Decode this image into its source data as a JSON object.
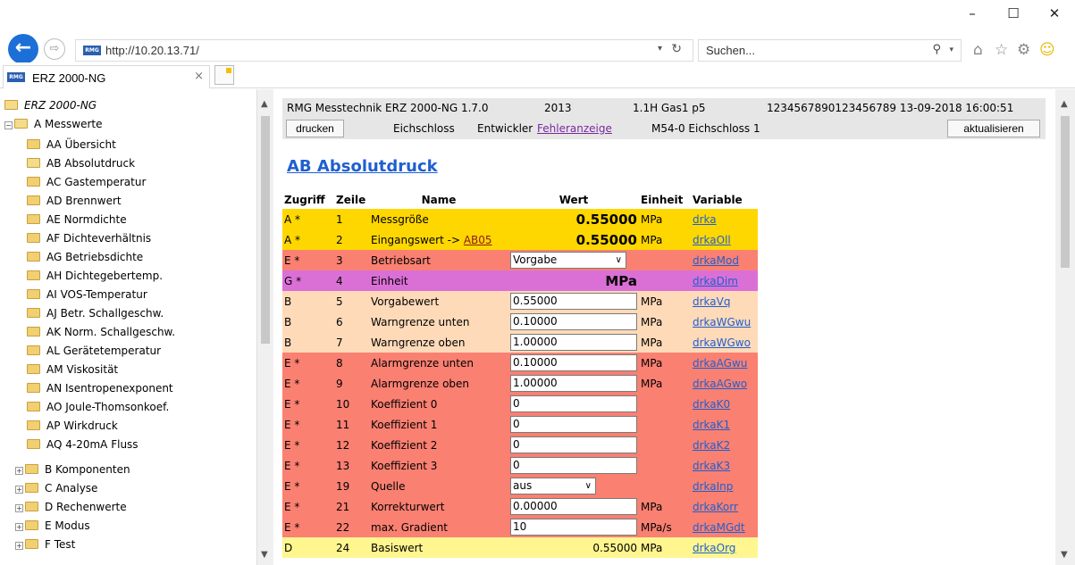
{
  "browser": {
    "url": "http://10.20.13.71/",
    "search_placeholder": "Suchen...",
    "tab_title": "ERZ 2000-NG",
    "logo_text": "RMG"
  },
  "tree": {
    "root": "ERZ 2000-NG",
    "open_group": "A Messwerte",
    "children": [
      "AA Übersicht",
      "AB Absolutdruck",
      "AC Gastemperatur",
      "AD Brennwert",
      "AE Normdichte",
      "AF Dichteverhältnis",
      "AG Betriebsdichte",
      "AH Dichtegebertemp.",
      "AI VOS-Temperatur",
      "AJ Betr. Schallgeschw.",
      "AK Norm. Schallgeschw.",
      "AL Gerätetemperatur",
      "AM Viskosität",
      "AN Isentropenexponent",
      "AO Joule-Thomsonkoef.",
      "AP Wirkdruck",
      "AQ 4-20mA Fluss"
    ],
    "groups": [
      "B Komponenten",
      "C Analyse",
      "D Rechenwerte",
      "E Modus",
      "F Test"
    ]
  },
  "status": {
    "device": "RMG Messtechnik ERZ 2000-NG 1.7.0",
    "year": "2013",
    "gas": "1.1H Gas1 p5",
    "serial_time": "1234567890123456789 13-09-2018 16:00:51",
    "print_label": "drucken",
    "eichschloss": "Eichschloss",
    "entwickler": "Entwickler",
    "fehler_link": "Fehleranzeige",
    "m54": "M54-0 Eichschloss 1",
    "refresh_label": "aktualisieren"
  },
  "page_title": "AB Absolutdruck",
  "table": {
    "headers": [
      "Zugriff",
      "Zeile",
      "Name",
      "Wert",
      "Einheit",
      "Variable"
    ],
    "rows": [
      {
        "zugriff": "A *",
        "zeile": "1",
        "name": "Messgröße",
        "wert": "0.55000",
        "einheit": "MPa",
        "variable": "drka",
        "type": "big",
        "color": "#ffd700"
      },
      {
        "zugriff": "A *",
        "zeile": "2",
        "name": "Eingangswert ->",
        "name_link": "AB05",
        "wert": "0.55000",
        "einheit": "MPa",
        "variable": "drkaOll",
        "type": "big",
        "color": "#ffd700"
      },
      {
        "zugriff": "E *",
        "zeile": "3",
        "name": "Betriebsart",
        "wert": "Vorgabe",
        "einheit": "",
        "variable": "drkaMod",
        "type": "select",
        "color": "#fa8072"
      },
      {
        "zugriff": "G *",
        "zeile": "4",
        "name": "Einheit",
        "wert": "MPa",
        "einheit": "",
        "variable": "drkaDim",
        "type": "big",
        "color": "#da70d6"
      },
      {
        "zugriff": "B",
        "zeile": "5",
        "name": "Vorgabewert",
        "wert": "0.55000",
        "einheit": "MPa",
        "variable": "drkaVq",
        "type": "input",
        "color": "#ffdab9"
      },
      {
        "zugriff": "B",
        "zeile": "6",
        "name": "Warngrenze unten",
        "wert": "0.10000",
        "einheit": "MPa",
        "variable": "drkaWGwu",
        "type": "input",
        "color": "#ffdab9"
      },
      {
        "zugriff": "B",
        "zeile": "7",
        "name": "Warngrenze oben",
        "wert": "1.00000",
        "einheit": "MPa",
        "variable": "drkaWGwo",
        "type": "input",
        "color": "#ffdab9"
      },
      {
        "zugriff": "E *",
        "zeile": "8",
        "name": "Alarmgrenze unten",
        "wert": "0.10000",
        "einheit": "MPa",
        "variable": "drkaAGwu",
        "type": "input",
        "color": "#fa8072"
      },
      {
        "zugriff": "E *",
        "zeile": "9",
        "name": "Alarmgrenze oben",
        "wert": "1.00000",
        "einheit": "MPa",
        "variable": "drkaAGwo",
        "type": "input",
        "color": "#fa8072"
      },
      {
        "zugriff": "E *",
        "zeile": "10",
        "name": "Koeffizient 0",
        "wert": "0",
        "einheit": "",
        "variable": "drkaK0",
        "type": "input",
        "color": "#fa8072"
      },
      {
        "zugriff": "E *",
        "zeile": "11",
        "name": "Koeffizient 1",
        "wert": "0",
        "einheit": "",
        "variable": "drkaK1",
        "type": "input",
        "color": "#fa8072"
      },
      {
        "zugriff": "E *",
        "zeile": "12",
        "name": "Koeffizient 2",
        "wert": "0",
        "einheit": "",
        "variable": "drkaK2",
        "type": "input",
        "color": "#fa8072"
      },
      {
        "zugriff": "E *",
        "zeile": "13",
        "name": "Koeffizient 3",
        "wert": "0",
        "einheit": "",
        "variable": "drkaK3",
        "type": "input",
        "color": "#fa8072"
      },
      {
        "zugriff": "E *",
        "zeile": "19",
        "name": "Quelle",
        "wert": "aus",
        "einheit": "",
        "variable": "drkaInp",
        "type": "select-short",
        "color": "#fa8072"
      },
      {
        "zugriff": "E *",
        "zeile": "21",
        "name": "Korrekturwert",
        "wert": "0.00000",
        "einheit": "MPa",
        "variable": "drkaKorr",
        "type": "input",
        "color": "#fa8072"
      },
      {
        "zugriff": "E *",
        "zeile": "22",
        "name": "max. Gradient",
        "wert": "10",
        "einheit": "MPa/s",
        "variable": "drkaMGdt",
        "type": "input",
        "color": "#fa8072"
      },
      {
        "zugriff": "D",
        "zeile": "24",
        "name": "Basiswert",
        "wert": "0.55000",
        "einheit": "MPa",
        "variable": "drkaOrg",
        "type": "plain",
        "color": "#fff68f"
      }
    ]
  }
}
